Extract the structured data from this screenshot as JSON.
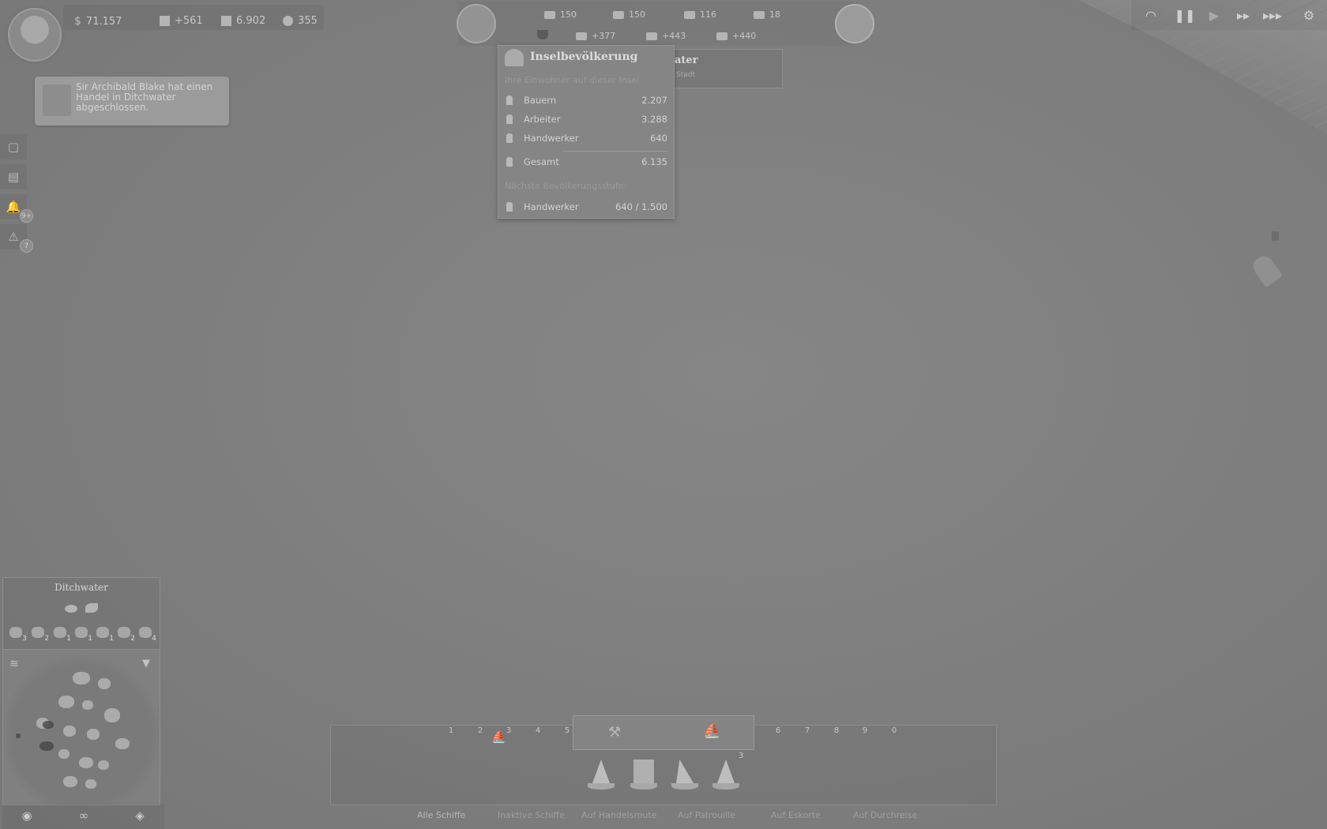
{
  "top_stats": {
    "money": "71.157",
    "income": "+561",
    "population": "6.902",
    "influence": "355"
  },
  "resources_row1": [
    {
      "icon": "timber-icon",
      "value": "150"
    },
    {
      "icon": "bricks-icon",
      "value": "150"
    },
    {
      "icon": "steel-beams-icon",
      "value": "116"
    },
    {
      "icon": "windows-icon",
      "value": "18"
    }
  ],
  "resources_row2": [
    {
      "icon": "tools-icon",
      "value": "+377"
    },
    {
      "icon": "hammer-icon",
      "value": "+443"
    },
    {
      "icon": "cart-icon",
      "value": "+440"
    }
  ],
  "notification": {
    "text": "Sir Archibald Blake hat einen Handel in Ditchwater abgeschlossen."
  },
  "side_badges": {
    "notifications": "9+",
    "warnings": "7"
  },
  "population_tooltip": {
    "title": "Inselbevölkerung",
    "hint": "Ihre Einwohner auf dieser Insel",
    "rows": [
      {
        "label": "Bauern",
        "value": "2.207"
      },
      {
        "label": "Arbeiter",
        "value": "3.288"
      },
      {
        "label": "Handwerker",
        "value": "640"
      }
    ],
    "total": {
      "label": "Gesamt",
      "value": "6.135"
    },
    "next_hint": "Nächste Bevölkerungsstufe:",
    "next": {
      "label": "Handwerker",
      "value": "640 / 1.500"
    }
  },
  "island_panel": {
    "title": "ater",
    "subtitle": "Stadt"
  },
  "island": {
    "name": "Ditchwater",
    "goods": [
      {
        "icon": "fish-icon",
        "count": "3"
      },
      {
        "icon": "wheat-icon",
        "count": "2"
      },
      {
        "icon": "pig-icon",
        "count": "1"
      },
      {
        "icon": "wool-icon",
        "count": "1"
      },
      {
        "icon": "beer-icon",
        "count": "1"
      },
      {
        "icon": "bread-icon",
        "count": "2"
      },
      {
        "icon": "sausage-icon",
        "count": "4"
      }
    ]
  },
  "fleet": {
    "slots_left": [
      "1",
      "2",
      "3",
      "4",
      "5"
    ],
    "slots_right": [
      "6",
      "7",
      "8",
      "9",
      "0"
    ],
    "ship_count": "3",
    "tabs": [
      "Alle Schiffe",
      "Inaktive Schiffe",
      "Auf Handelsroute",
      "Auf Patrouille",
      "Auf Eskorte",
      "Auf Durchreise"
    ]
  }
}
